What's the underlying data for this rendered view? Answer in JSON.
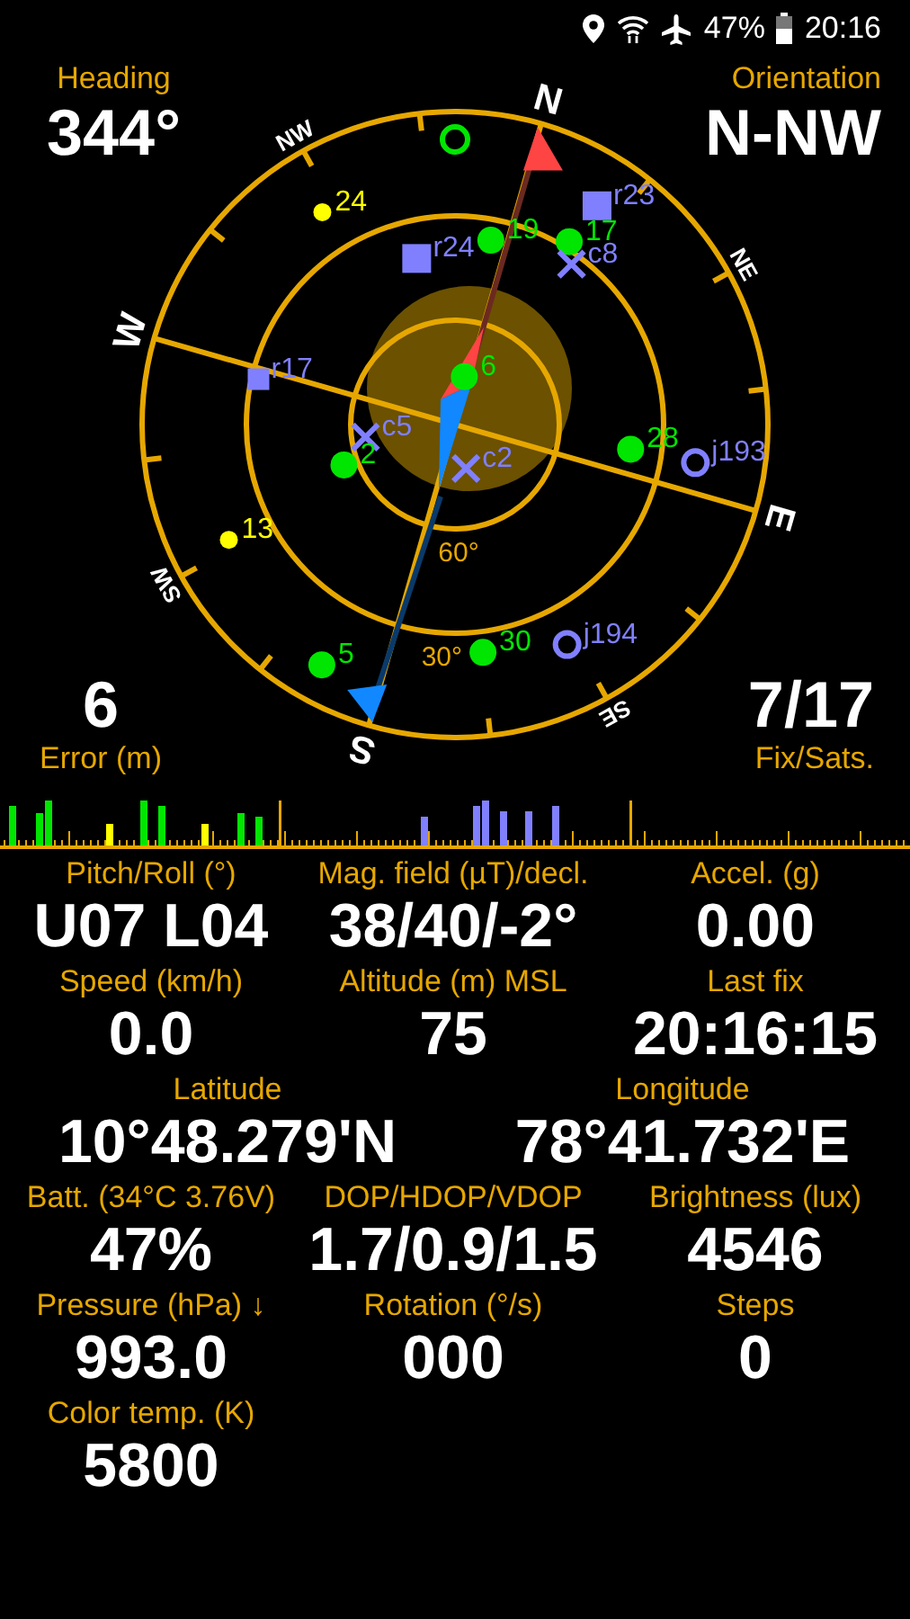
{
  "status_bar": {
    "battery": "47%",
    "time": "20:16"
  },
  "heading": {
    "label": "Heading",
    "value": "344°"
  },
  "orientation": {
    "label": "Orientation",
    "value": "N-NW"
  },
  "error": {
    "label": "Error (m)",
    "value": "6"
  },
  "fix": {
    "label": "Fix/Sats.",
    "value": "7/17"
  },
  "sky_plot": {
    "compass_labels": [
      "N",
      "NE",
      "E",
      "SE",
      "S",
      "SW",
      "W",
      "NW"
    ],
    "elevation_labels": [
      "30°",
      "60°"
    ],
    "satellites": [
      {
        "kind": "hollow",
        "color": "#00e600"
      },
      {
        "label": "24",
        "kind": "dot",
        "color": "#ffff00"
      },
      {
        "label": "r23",
        "kind": "square",
        "color": "#8080ff"
      },
      {
        "label": "r24",
        "kind": "square",
        "color": "#8080ff"
      },
      {
        "label": "19",
        "kind": "circle",
        "color": "#00e600"
      },
      {
        "label": "17",
        "kind": "circle",
        "color": "#00e600"
      },
      {
        "label": "c8",
        "kind": "cross",
        "color": "#8080ff"
      },
      {
        "label": "r17",
        "kind": "small-square",
        "color": "#8080ff"
      },
      {
        "label": "6",
        "kind": "circle",
        "color": "#00e600"
      },
      {
        "label": "c5",
        "kind": "cross",
        "color": "#8080ff"
      },
      {
        "label": "2",
        "kind": "circle",
        "color": "#00e600"
      },
      {
        "label": "c2",
        "kind": "cross",
        "color": "#8080ff"
      },
      {
        "label": "28",
        "kind": "circle",
        "color": "#00e600"
      },
      {
        "label": "j193",
        "kind": "ring",
        "color": "#8080ff"
      },
      {
        "label": "13",
        "kind": "dot",
        "color": "#ffff00"
      },
      {
        "label": "5",
        "kind": "circle",
        "color": "#00e600"
      },
      {
        "label": "30",
        "kind": "circle",
        "color": "#00e600"
      },
      {
        "label": "j194",
        "kind": "ring",
        "color": "#8080ff"
      }
    ]
  },
  "readings": [
    [
      {
        "label": "Pitch/Roll (°)",
        "value": "U07 L04"
      },
      {
        "label": "Mag. field (µT)/decl.",
        "value": "38/40/-2°"
      },
      {
        "label": "Accel. (g)",
        "value": "0.00"
      }
    ],
    [
      {
        "label": "Speed (km/h)",
        "value": "0.0"
      },
      {
        "label": "Altitude (m) MSL",
        "value": "75"
      },
      {
        "label": "Last fix",
        "value": "20:16:15"
      }
    ],
    [
      {
        "label": "Latitude",
        "value": "10°48.279'N"
      },
      {
        "label": "Longitude",
        "value": "78°41.732'E"
      }
    ],
    [
      {
        "label": "Batt. (34°C 3.76V)",
        "value": "47%"
      },
      {
        "label": "DOP/HDOP/VDOP",
        "value": "1.7/0.9/1.5"
      },
      {
        "label": "Brightness (lux)",
        "value": "4546"
      }
    ],
    [
      {
        "label": "Pressure (hPa) ↓",
        "value": "993.0"
      },
      {
        "label": "Rotation (°/s)",
        "value": "000"
      },
      {
        "label": "Steps",
        "value": "0"
      }
    ],
    [
      {
        "label": "Color temp. (K)",
        "value": "5800"
      }
    ]
  ]
}
